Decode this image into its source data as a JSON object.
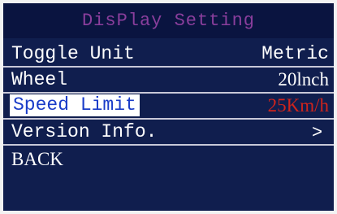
{
  "screen": {
    "title": "DisPlay Setting",
    "colors": {
      "background": "#101e4e",
      "title_bar": "#0a1440",
      "title_text": "#8a3e9c",
      "text": "#ffffff",
      "highlight_bg": "#ffffff",
      "highlight_text": "#1a3cc8",
      "value_selected": "#d0241c"
    }
  },
  "menu": {
    "items": [
      {
        "label": "Toggle Unit",
        "value": "Metric"
      },
      {
        "label": "Wheel",
        "value": "20lnch"
      },
      {
        "label": "Speed Limit",
        "value": "25Km/h",
        "selected": true
      },
      {
        "label": "Version Info.",
        "value": ">",
        "icon": "chevron-right-icon"
      },
      {
        "label": "BACK"
      }
    ]
  }
}
